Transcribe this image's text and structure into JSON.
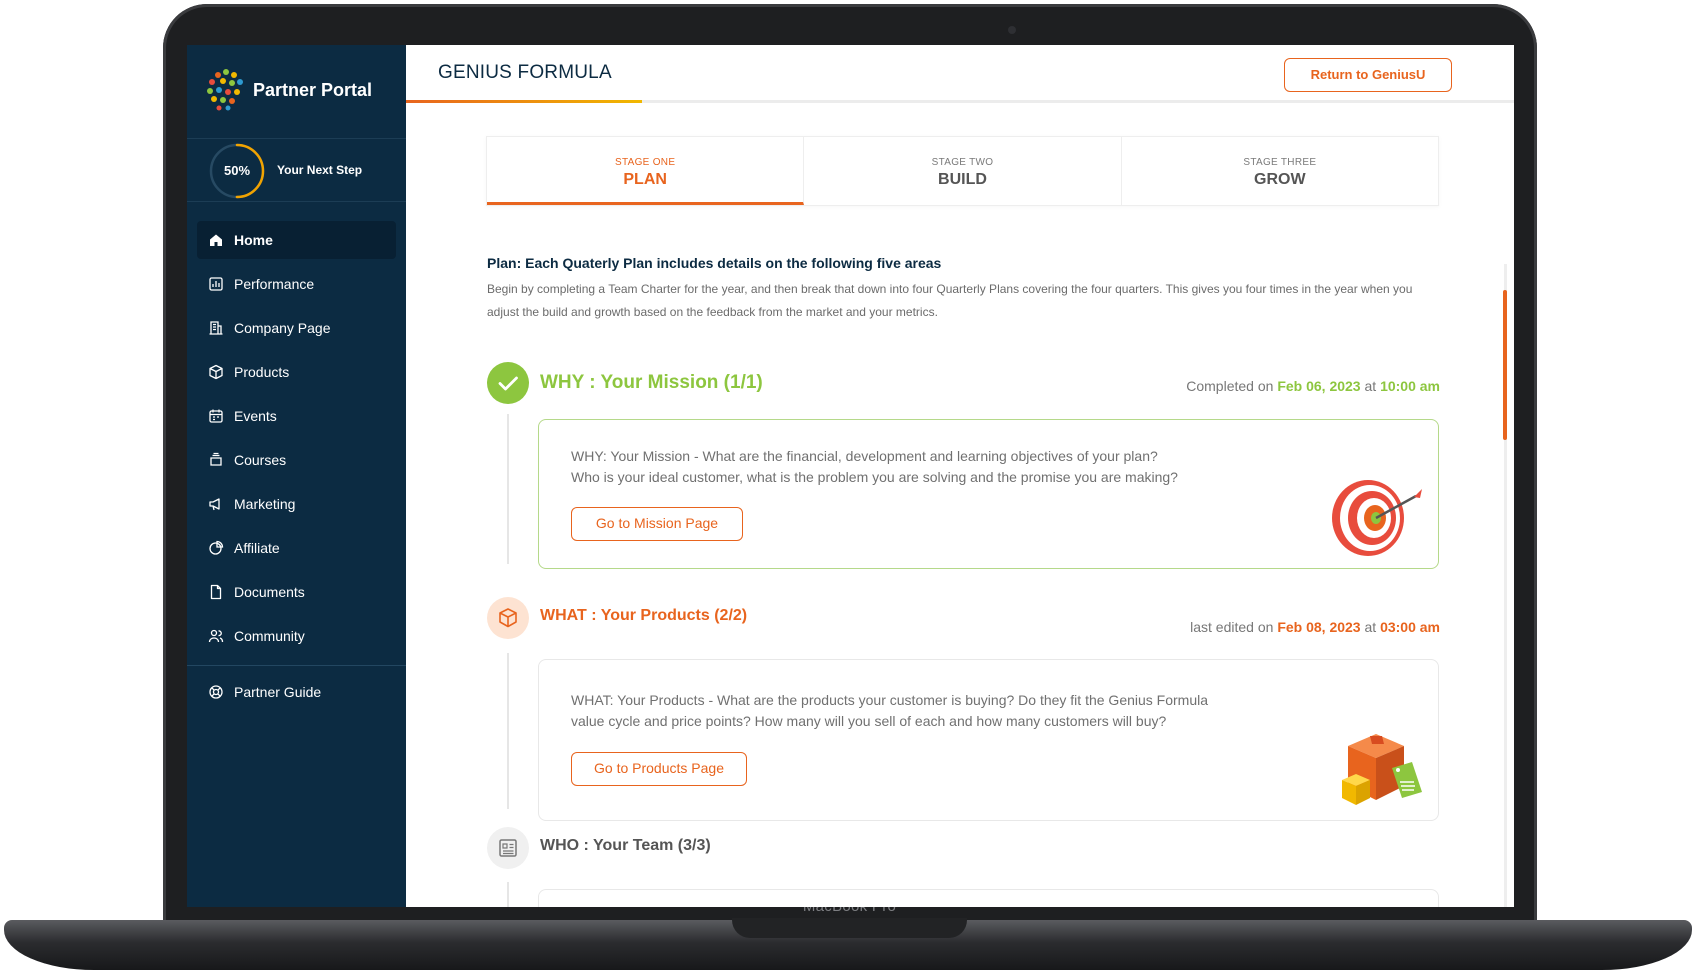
{
  "device": {
    "brand_label": "MacBook Pro"
  },
  "sidebar": {
    "logo_text": "Partner Portal",
    "progress": {
      "percent_label": "50%",
      "value": 0.5,
      "label": "Your Next Step"
    },
    "items": [
      {
        "label": "Home",
        "icon": "home-icon",
        "active": true
      },
      {
        "label": "Performance",
        "icon": "chart-icon"
      },
      {
        "label": "Company Page",
        "icon": "building-icon"
      },
      {
        "label": "Products",
        "icon": "box-icon"
      },
      {
        "label": "Events",
        "icon": "calendar-icon"
      },
      {
        "label": "Courses",
        "icon": "layers-icon"
      },
      {
        "label": "Marketing",
        "icon": "megaphone-icon"
      },
      {
        "label": "Affiliate",
        "icon": "pie-chart-icon"
      },
      {
        "label": "Documents",
        "icon": "document-icon"
      },
      {
        "label": "Community",
        "icon": "users-icon"
      }
    ],
    "guide": {
      "label": "Partner Guide",
      "icon": "help-wheel-icon"
    }
  },
  "header": {
    "title": "GENIUS FORMULA",
    "return_button": "Return to GeniusU"
  },
  "stages": [
    {
      "small": "STAGE ONE",
      "big": "PLAN",
      "active": true
    },
    {
      "small": "STAGE TWO",
      "big": "BUILD"
    },
    {
      "small": "STAGE THREE",
      "big": "GROW"
    }
  ],
  "plan": {
    "title": "Plan: Each Quaterly Plan includes details on the following five areas",
    "description": "Begin by completing a Team Charter for the year, and then break that down into four Quarterly Plans covering the four quarters. This gives you four times in the year when you adjust the build and growth based on the feedback from the market and your metrics."
  },
  "sections": {
    "why": {
      "title": "WHY : Your Mission (1/1)",
      "meta_prefix": "Completed on",
      "date": "Feb 06, 2023",
      "at": "at",
      "time": "10:00 am",
      "text_line1": "WHY: Your Mission - What are the financial, development and learning objectives of your plan?",
      "text_line2": "Who is your ideal customer, what is the problem you are solving and the promise you are making?",
      "button": "Go to Mission Page",
      "illustration": "target-dart-illustration"
    },
    "what": {
      "title": "WHAT : Your Products (2/2)",
      "meta_prefix": "last edited on",
      "date": "Feb 08, 2023",
      "at": "at",
      "time": "03:00 am",
      "text_line1": "WHAT: Your Products - What are the products your customer is buying? Do they fit the Genius Formula",
      "text_line2": "value cycle and price points? How many will you sell of each and how many customers will buy?",
      "button": "Go to Products Page",
      "illustration": "product-boxes-illustration"
    },
    "who": {
      "title": "WHO : Your Team (3/3)"
    }
  },
  "colors": {
    "sidebar_bg": "#0c2b42",
    "accent_orange": "#e8641e",
    "complete_green": "#8dc63f"
  }
}
